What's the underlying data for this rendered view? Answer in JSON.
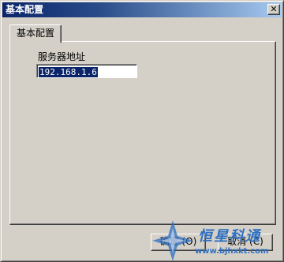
{
  "window": {
    "title": "基本配置",
    "close_glyph": "✕"
  },
  "tabs": [
    {
      "label": "基本配置",
      "selected": true
    }
  ],
  "form": {
    "server_address_label": "服务器地址",
    "server_address_value": "192.168.1.6"
  },
  "buttons": {
    "ok_label": "确定 (O)",
    "cancel_label": "取消 (C)"
  },
  "watermark": {
    "logo_text": "恒星科通",
    "url": "www.bjhxkt.com"
  },
  "colors": {
    "titlebar_start": "#0a246a",
    "titlebar_end": "#a6caf0",
    "face": "#d4d0c8",
    "selection": "#0a246a",
    "watermark": "#2e6fc0"
  }
}
